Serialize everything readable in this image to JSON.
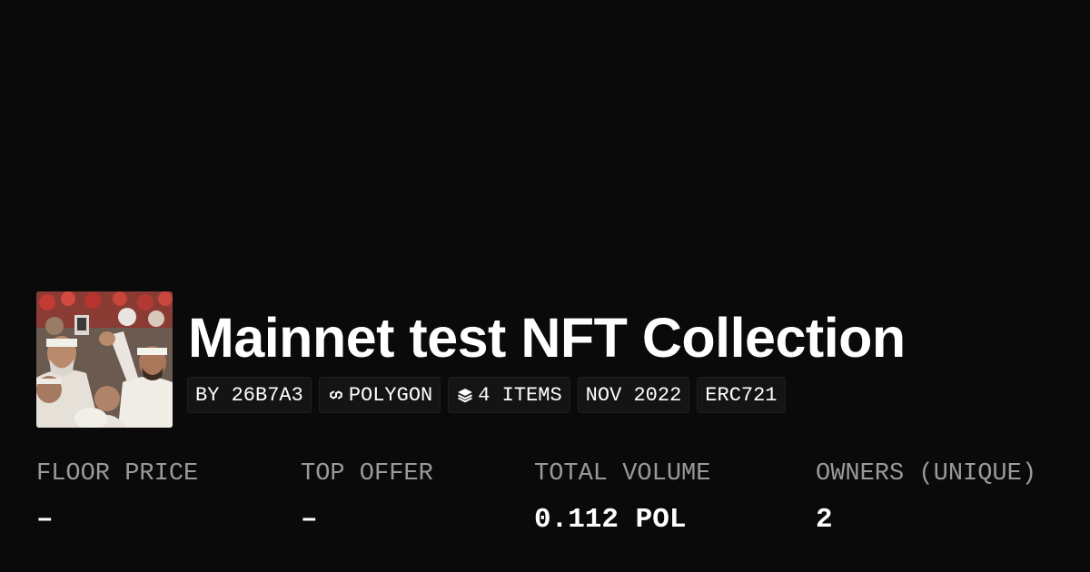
{
  "collection": {
    "title": "Mainnet test NFT Collection",
    "thumbnail_icon": "collection-thumbnail"
  },
  "tags": {
    "creator": "BY 26B7A3",
    "chain": "POLYGON",
    "chain_icon": "polygon-icon",
    "items": "4 ITEMS",
    "items_icon": "layers-icon",
    "date": "NOV 2022",
    "standard": "ERC721"
  },
  "stats": [
    {
      "label": "FLOOR PRICE",
      "value": "–"
    },
    {
      "label": "TOP OFFER",
      "value": "–"
    },
    {
      "label": "TOTAL VOLUME",
      "value": "0.112 POL"
    },
    {
      "label": "OWNERS (UNIQUE)",
      "value": "2"
    }
  ],
  "colors": {
    "background": "#0a0a0a",
    "text": "#ffffff",
    "muted": "#9a9a9a",
    "tag_bg": "#141414"
  }
}
